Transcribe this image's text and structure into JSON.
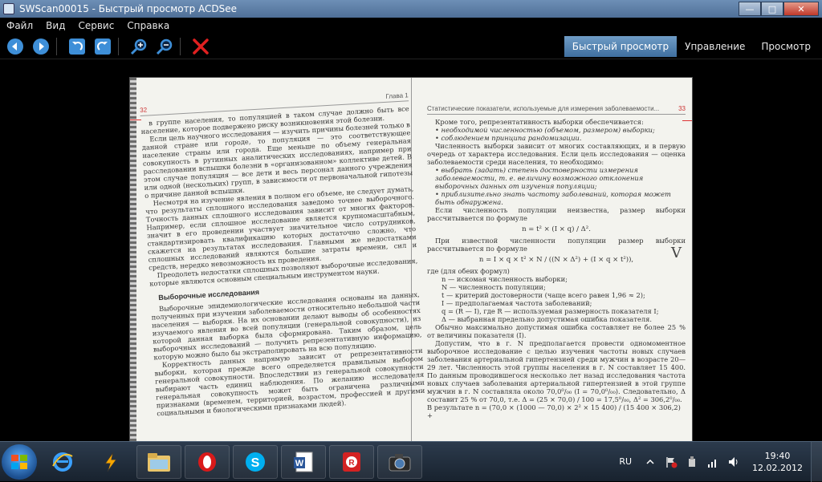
{
  "window": {
    "title": "SWScan00015 - Быстрый просмотр ACDSee"
  },
  "menu": [
    "Файл",
    "Вид",
    "Сервис",
    "Справка"
  ],
  "modes": {
    "quick_view": "Быстрый просмотр",
    "manage": "Управление",
    "view": "Просмотр"
  },
  "document": {
    "left": {
      "page_number": "32",
      "chapter": "Глава 1",
      "paragraphs": [
        "в группе населения, то популяцией в таком случае должно быть все население, которое подвержено риску возникновения этой болезни.",
        "Если цель научного исследования — изучить причины болезней только в данной стране или городе, то популяция — это соответствующее население страны или города. Еще меньше по объему генеральная совокупность в рутинных аналитических исследованиях, например при расследовании вспышки болезни в «организованном» коллективе детей. В этом случае популяция — все дети и весь персонал данного учреждения или одной (нескольких) групп, в зависимости от первоначальной гипотезы о причине данной вспышки.",
        "Несмотря на изучение явления в полном его объеме, не следует думать, что результаты сплошного исследования заведомо точнее выборочного. Точность данных сплошного исследования зависит от многих факторов. Например, если сплошное исследование является крупномасштабным, значит в его проведении участвует значительное число сотрудников, стандартизировать квалификацию которых достаточно сложно, что скажется на результатах исследования. Главными же недостатками сплошных исследований являются большие затраты времени, сил и средств, нередко невозможность их проведения.",
        "Преодолеть недостатки сплошных позволяют выборочные исследования, которые являются основным специальным инструментом науки."
      ],
      "heading": "Выборочные исследования",
      "paragraphs2": [
        "Выборочные эпидемиологические исследования основаны на данных, полученных при изучении заболеваемости относительно небольшой части населения — выборки. На их основании делают выводы об особенностях изучаемого явления во всей популяции (генеральной совокупности), из которой данная выборка была сформирована. Таким образом, цель выборочных исследований — получить репрезентативную информацию, которую можно было бы экстраполировать на всю популяцию.",
        "Корректность данных напрямую зависит от репрезентативности выборки, которая прежде всего определяется правильным выбором генеральной совокупности. Впоследствии из генеральной совокупности выбирают часть единиц наблюдения. По желанию исследователя генеральная совокупность может быть ограничена различными признаками (временем, территорией, возрастом, профессией и другими социальными и биологическими признаками людей)."
      ]
    },
    "right": {
      "header": "Статистические показатели, используемые для измерения заболеваемости...",
      "page_number": "33",
      "intro": "Кроме того, репрезентативность выборки обеспечивается:",
      "bullets1": [
        "необходимой численностью (объемом, размером) выборки;",
        "соблюдением принципа рандомизации."
      ],
      "p1": "Численность выборки зависит от многих составляющих, и в первую очередь от характера исследования. Если цель исследования — оценка заболеваемости среди населения, то необходимо:",
      "bullets2": [
        "выбрать (задать) степень достоверности измерения заболеваемости, т. е. величину возможного отклонения выборочных данных от изучения популяции;",
        "приблизительно знать частоту заболеваний, которая может быть обнаружена."
      ],
      "p2": "Если численность популяции неизвестна, размер выборки рассчитывается по формуле",
      "formula1": "n = t² × (I × q) / Δ².",
      "p3": "При известной численности популяции размер выборки рассчитывается по формуле",
      "formula2": "n = I × q × t² × N / ((N × Δ²) + (I × q × t²)),",
      "where": "где (для обеих формул)",
      "defs": [
        "n — искомая численность выборки;",
        "N — численность популяции;",
        "t — критерий достоверности (чаще всего равен 1,96 ≈ 2);",
        "I — предполагаемая частота заболеваний;",
        "q = (R — I), где R — используемая размерность показателя I;",
        "Δ — выбранная предельно допустимая ошибка показателя."
      ],
      "p4": "Обычно максимально допустимая ошибка составляет не более 25 % от величины показателя (I).",
      "p5": "Допустим, что в г. N предполагается провести одномоментное выборочное исследование с целью изучения частоты новых случаев заболевания артериальной гипертензией среди мужчин в возрасте 20—29 лет. Численность этой группы населения в г. N составляет 15 400. По данным проводившегося несколько лет назад исследования частота новых случаев заболевания артериальной гипертензией в этой группе мужчин в г. N составляла около 70,0⁰/₀₀ (I = 70,0⁰/₀₀). Следовательно, Δ составит 25 % от 70,0, т.е. Δ = (25 × 70,0) / 100 = 17,5⁰/₀₀, Δ² = 306,2⁰/₀₀.",
      "p6": "В результате n = (70,0 × (1000 — 70,0) × 2² × 15 400) / (15 400 × 306,2) +"
    },
    "margin_mark": "V"
  },
  "taskbar": {
    "apps": [
      "windows-start",
      "internet-explorer",
      "winamp",
      "file-explorer",
      "opera",
      "skype",
      "word",
      "foxit-reader",
      "acdsee"
    ],
    "lang": "RU",
    "time": "19:40",
    "date": "12.02.2012"
  },
  "colors": {
    "accent": "#4f80b0",
    "close": "#c0392b"
  }
}
